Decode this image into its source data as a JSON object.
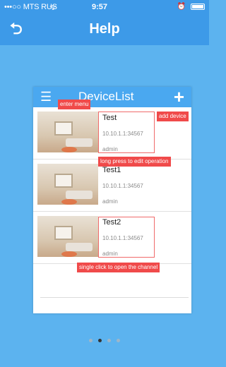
{
  "status_bar": {
    "carrier": "•••○○ MTS RUS",
    "wifi": "ᯤ",
    "time": "9:57",
    "right": "⏰"
  },
  "nav": {
    "back_icon": "undo-arrow-icon",
    "title": "Help"
  },
  "device_list": {
    "title": "DeviceList",
    "menu_icon": "menu-icon",
    "add_icon": "plus-icon",
    "devices": [
      {
        "name": "Test",
        "address": "10.10.1.1:34567",
        "user": "admin"
      },
      {
        "name": "Test1",
        "address": "10.10.1.1:34567",
        "user": "admin"
      },
      {
        "name": "Test2",
        "address": "10.10.1.1:34567",
        "user": "admin"
      }
    ]
  },
  "tips": {
    "enter_menu": "enter menu",
    "add_device": "add device",
    "long_press": "long press to edit operation",
    "single_click": "single click to open the channel"
  },
  "pager": {
    "count": 4,
    "active_index": 1
  },
  "colors": {
    "nav": "#3d9ae8",
    "background": "#5cb3ef",
    "tip": "#f04a4a",
    "card_header": "#4aa8f0"
  }
}
